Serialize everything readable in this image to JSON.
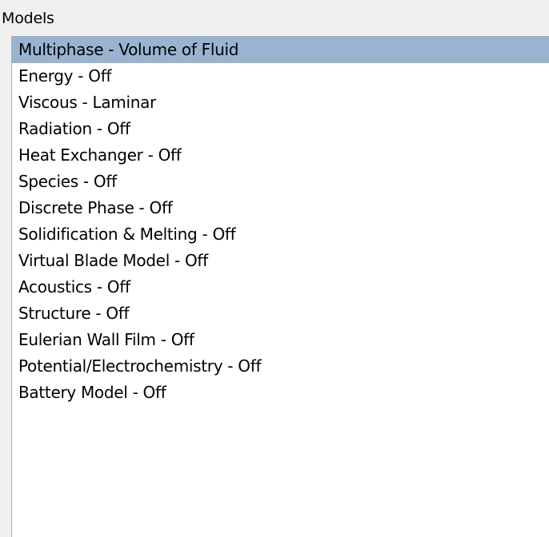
{
  "panel": {
    "title": "Models"
  },
  "models": {
    "selected_index": 0,
    "selected_color": "#99b4d1",
    "items": [
      {
        "label": "Multiphase - Volume of Fluid"
      },
      {
        "label": "Energy - Off"
      },
      {
        "label": "Viscous - Laminar"
      },
      {
        "label": "Radiation - Off"
      },
      {
        "label": "Heat Exchanger - Off"
      },
      {
        "label": "Species - Off"
      },
      {
        "label": "Discrete Phase - Off"
      },
      {
        "label": "Solidification & Melting - Off"
      },
      {
        "label": "Virtual Blade Model - Off"
      },
      {
        "label": "Acoustics - Off"
      },
      {
        "label": "Structure - Off"
      },
      {
        "label": "Eulerian Wall Film - Off"
      },
      {
        "label": "Potential/Electrochemistry - Off"
      },
      {
        "label": "Battery Model - Off"
      }
    ]
  }
}
